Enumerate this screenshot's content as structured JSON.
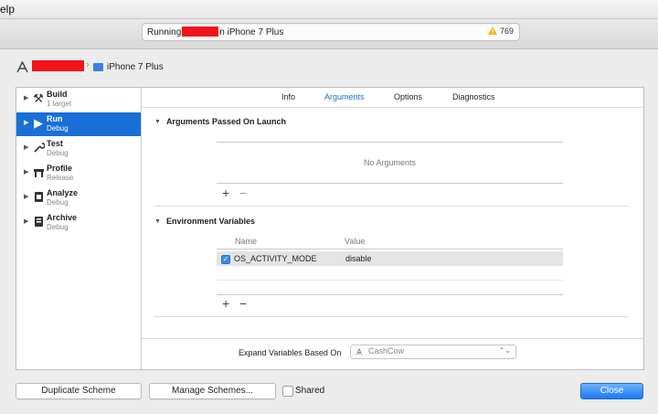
{
  "menubar": {
    "help_label": "elp"
  },
  "activity": {
    "running_prefix": "Running",
    "running_suffix": "n iPhone 7 Plus",
    "warning_count": "769"
  },
  "breadcrumb": {
    "device": "iPhone 7 Plus"
  },
  "sidebar": {
    "items": [
      {
        "name": "Build",
        "sub": "1 target",
        "icon": "hammer-icon",
        "glyph": "⚒"
      },
      {
        "name": "Run",
        "sub": "Debug",
        "icon": "play-icon",
        "glyph": "▶"
      },
      {
        "name": "Test",
        "sub": "Debug",
        "icon": "wrench-icon",
        "glyph": "🔧"
      },
      {
        "name": "Profile",
        "sub": "Release",
        "icon": "instruments-icon",
        "glyph": "⚙"
      },
      {
        "name": "Analyze",
        "sub": "Debug",
        "icon": "analyze-icon",
        "glyph": "▣"
      },
      {
        "name": "Archive",
        "sub": "Debug",
        "icon": "archive-icon",
        "glyph": "▤"
      }
    ],
    "selected": "Run"
  },
  "tabs": [
    {
      "label": "Info"
    },
    {
      "label": "Arguments"
    },
    {
      "label": "Options"
    },
    {
      "label": "Diagnostics"
    }
  ],
  "active_tab": "Arguments",
  "arguments": {
    "title": "Arguments Passed On Launch",
    "empty": "No Arguments"
  },
  "environment": {
    "title": "Environment Variables",
    "col_name": "Name",
    "col_value": "Value",
    "rows": [
      {
        "name": "OS_ACTIVITY_MODE",
        "value": "disable",
        "checked": true
      }
    ]
  },
  "expand": {
    "label": "Expand Variables Based On",
    "value": "CashCow"
  },
  "buttons": {
    "duplicate": "Duplicate Scheme",
    "manage": "Manage Schemes...",
    "shared": "Shared",
    "close": "Close"
  },
  "colors": {
    "accent": "#1a6fd6",
    "redaction": "#f2141a"
  }
}
